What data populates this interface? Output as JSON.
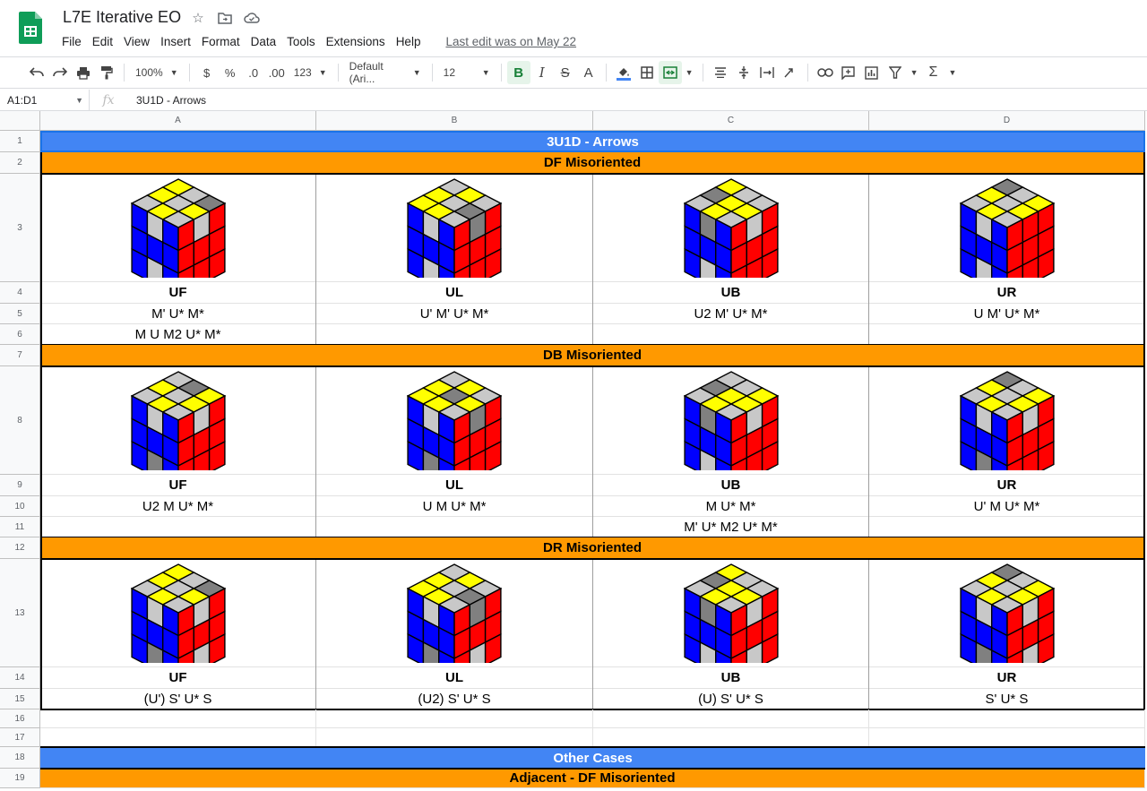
{
  "app": {
    "doc_title": "L7E Iterative EO",
    "menu": [
      "File",
      "Edit",
      "View",
      "Insert",
      "Format",
      "Data",
      "Tools",
      "Extensions",
      "Help"
    ],
    "last_edit": "Last edit was on May 22"
  },
  "toolbar": {
    "zoom": "100%",
    "currency": "$",
    "percent": "%",
    "decrease_decimals": ".0",
    "increase_decimals": ".00",
    "more_formats": "123",
    "font": "Default (Ari...",
    "font_size": "12",
    "bold": "B",
    "italic": "I",
    "strikethrough": "S",
    "text_color": "A"
  },
  "formula_bar": {
    "name_box": "A1:D1",
    "fx": "fx",
    "value": "3U1D - Arrows"
  },
  "columns": [
    "A",
    "B",
    "C",
    "D"
  ],
  "rows": [
    "1",
    "2",
    "3",
    "4",
    "5",
    "6",
    "7",
    "8",
    "9",
    "10",
    "11",
    "12",
    "13",
    "14",
    "15",
    "16",
    "17",
    "18",
    "19"
  ],
  "sheet": {
    "title": "3U1D - Arrows",
    "sections": [
      {
        "header": "DF Misoriented",
        "cases": [
          {
            "label": "UF",
            "algs": [
              "M' U* M*",
              "M U M2 U* M*"
            ],
            "cube": {
              "top": [
                "Y",
                "G",
                "D",
                "Y",
                "G",
                "Y",
                "G",
                "Y",
                "G"
              ],
              "front": [
                "B",
                "G",
                "B",
                "B",
                "B",
                "B",
                "B",
                "G",
                "B"
              ],
              "right": [
                "R",
                "G",
                "R",
                "R",
                "R",
                "R",
                "R",
                "R",
                "R"
              ]
            }
          },
          {
            "label": "UL",
            "algs": [
              "U' M' U* M*",
              ""
            ],
            "cube": {
              "top": [
                "G",
                "Y",
                "G",
                "Y",
                "G",
                "D",
                "Y",
                "Y",
                "G"
              ],
              "front": [
                "B",
                "G",
                "B",
                "B",
                "B",
                "B",
                "B",
                "G",
                "B"
              ],
              "right": [
                "R",
                "D",
                "R",
                "R",
                "R",
                "R",
                "R",
                "R",
                "R"
              ]
            }
          },
          {
            "label": "UB",
            "algs": [
              "U2 M' U* M*",
              ""
            ],
            "cube": {
              "top": [
                "Y",
                "G",
                "G",
                "D",
                "Y",
                "Y",
                "G",
                "Y",
                "G"
              ],
              "front": [
                "B",
                "D",
                "B",
                "B",
                "B",
                "B",
                "B",
                "G",
                "B"
              ],
              "right": [
                "R",
                "G",
                "R",
                "R",
                "R",
                "R",
                "R",
                "R",
                "R"
              ]
            }
          },
          {
            "label": "UR",
            "algs": [
              "U M' U* M*",
              ""
            ],
            "cube": {
              "top": [
                "D",
                "G",
                "Y",
                "Y",
                "G",
                "Y",
                "G",
                "Y",
                "G"
              ],
              "front": [
                "B",
                "G",
                "B",
                "B",
                "B",
                "B",
                "B",
                "G",
                "B"
              ],
              "right": [
                "R",
                "R",
                "R",
                "R",
                "R",
                "R",
                "R",
                "R",
                "R"
              ]
            }
          }
        ]
      },
      {
        "header": "DB Misoriented",
        "cases": [
          {
            "label": "UF",
            "algs": [
              "U2 M U* M*",
              ""
            ],
            "cube": {
              "top": [
                "G",
                "D",
                "Y",
                "Y",
                "G",
                "Y",
                "G",
                "Y",
                "G"
              ],
              "front": [
                "B",
                "G",
                "B",
                "B",
                "B",
                "B",
                "B",
                "D",
                "B"
              ],
              "right": [
                "R",
                "G",
                "R",
                "R",
                "R",
                "R",
                "R",
                "R",
                "R"
              ]
            }
          },
          {
            "label": "UL",
            "algs": [
              "U M U* M*",
              ""
            ],
            "cube": {
              "top": [
                "G",
                "Y",
                "G",
                "Y",
                "D",
                "Y",
                "Y",
                "Y",
                "G"
              ],
              "front": [
                "B",
                "G",
                "B",
                "B",
                "B",
                "B",
                "B",
                "D",
                "B"
              ],
              "right": [
                "R",
                "D",
                "R",
                "R",
                "R",
                "R",
                "R",
                "R",
                "R"
              ]
            }
          },
          {
            "label": "UB",
            "algs": [
              "M U* M*",
              "M' U* M2 U* M*"
            ],
            "cube": {
              "top": [
                "G",
                "G",
                "Y",
                "D",
                "Y",
                "Y",
                "G",
                "Y",
                "G"
              ],
              "front": [
                "B",
                "D",
                "B",
                "B",
                "B",
                "B",
                "B",
                "G",
                "B"
              ],
              "right": [
                "R",
                "G",
                "R",
                "R",
                "R",
                "R",
                "R",
                "R",
                "R"
              ]
            }
          },
          {
            "label": "UR",
            "algs": [
              "U' M U* M*",
              ""
            ],
            "cube": {
              "top": [
                "D",
                "G",
                "Y",
                "Y",
                "G",
                "Y",
                "G",
                "Y",
                "G"
              ],
              "front": [
                "B",
                "G",
                "B",
                "B",
                "B",
                "B",
                "B",
                "D",
                "B"
              ],
              "right": [
                "R",
                "G",
                "R",
                "R",
                "R",
                "R",
                "R",
                "R",
                "R"
              ]
            }
          }
        ]
      },
      {
        "header": "DR Misoriented",
        "cases": [
          {
            "label": "UF",
            "algs": [
              "(U') S' U* S"
            ],
            "cube": {
              "top": [
                "Y",
                "G",
                "D",
                "Y",
                "G",
                "Y",
                "G",
                "Y",
                "G"
              ],
              "front": [
                "B",
                "G",
                "B",
                "B",
                "B",
                "B",
                "B",
                "D",
                "B"
              ],
              "right": [
                "R",
                "G",
                "R",
                "R",
                "R",
                "R",
                "R",
                "G",
                "R"
              ]
            }
          },
          {
            "label": "UL",
            "algs": [
              "(U2) S' U* S"
            ],
            "cube": {
              "top": [
                "G",
                "Y",
                "G",
                "Y",
                "G",
                "D",
                "Y",
                "Y",
                "G"
              ],
              "front": [
                "B",
                "G",
                "B",
                "B",
                "B",
                "B",
                "B",
                "D",
                "B"
              ],
              "right": [
                "R",
                "D",
                "R",
                "R",
                "R",
                "R",
                "R",
                "G",
                "R"
              ]
            }
          },
          {
            "label": "UB",
            "algs": [
              "(U) S' U* S"
            ],
            "cube": {
              "top": [
                "Y",
                "G",
                "G",
                "D",
                "Y",
                "Y",
                "G",
                "Y",
                "G"
              ],
              "front": [
                "B",
                "D",
                "B",
                "B",
                "B",
                "B",
                "B",
                "G",
                "B"
              ],
              "right": [
                "R",
                "G",
                "R",
                "R",
                "R",
                "R",
                "R",
                "G",
                "R"
              ]
            }
          },
          {
            "label": "UR",
            "algs": [
              "S' U* S"
            ],
            "cube": {
              "top": [
                "D",
                "G",
                "Y",
                "Y",
                "G",
                "Y",
                "G",
                "Y",
                "G"
              ],
              "front": [
                "B",
                "G",
                "B",
                "B",
                "B",
                "B",
                "B",
                "D",
                "B"
              ],
              "right": [
                "R",
                "G",
                "R",
                "R",
                "R",
                "R",
                "R",
                "G",
                "R"
              ]
            }
          }
        ]
      }
    ],
    "other_cases": "Other Cases",
    "adjacent_header": "Adjacent - DF Misoriented"
  },
  "colors": {
    "Y": "#ffff00",
    "G": "#c8c8c8",
    "D": "#808080",
    "B": "#0000ff",
    "R": "#ff0000",
    "blue_header": "#4285f4",
    "orange_header": "#ff9900"
  }
}
